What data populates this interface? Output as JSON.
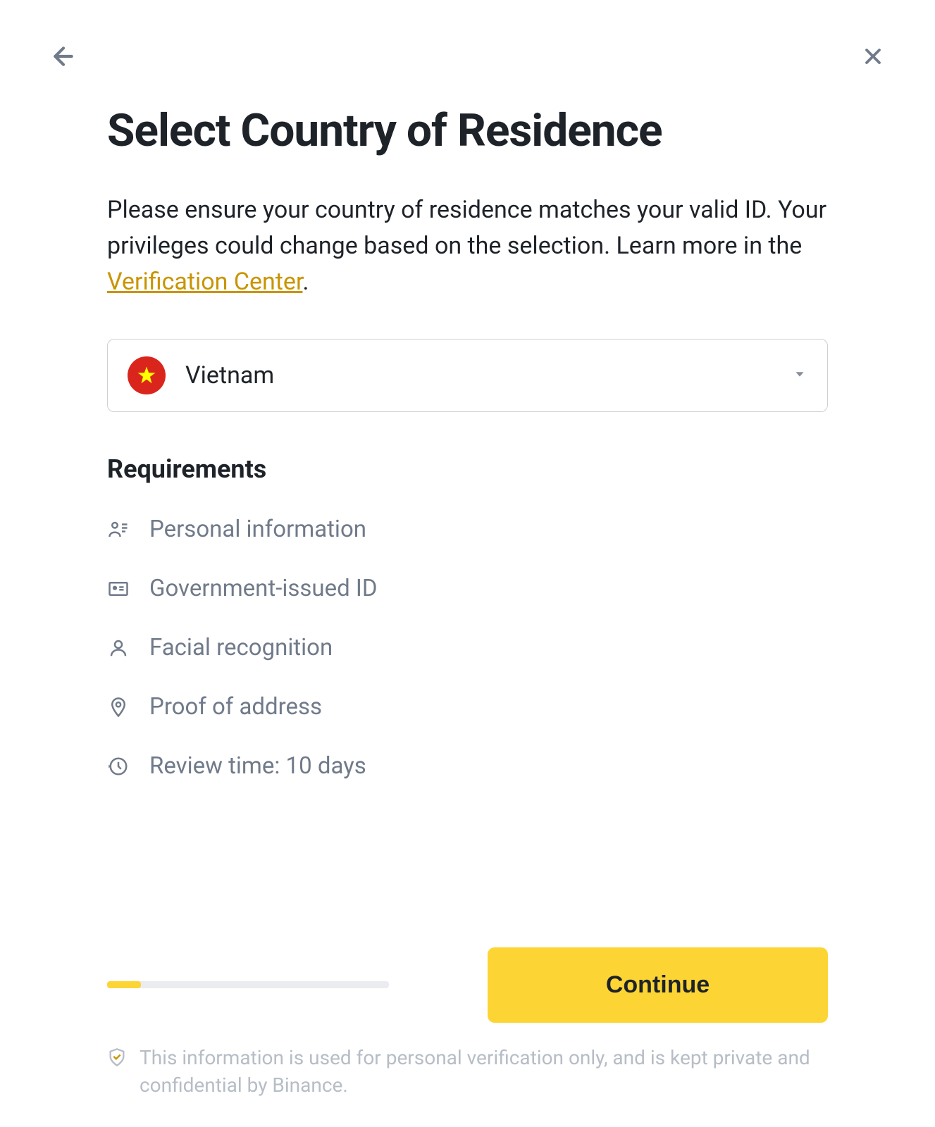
{
  "header": {
    "title": "Select Country of Residence"
  },
  "description": {
    "text_before_link": "Please ensure your country of residence matches your valid ID. Your privileges could change based on the selection. Learn more in the ",
    "link_text": "Verification Center",
    "text_after_link": "."
  },
  "country_select": {
    "selected": "Vietnam"
  },
  "requirements": {
    "heading": "Requirements",
    "items": [
      {
        "label": "Personal information"
      },
      {
        "label": "Government-issued ID"
      },
      {
        "label": "Facial recognition"
      },
      {
        "label": "Proof of address"
      },
      {
        "label": "Review time: 10 days"
      }
    ]
  },
  "progress": {
    "percent": 12
  },
  "actions": {
    "continue_label": "Continue"
  },
  "disclaimer": {
    "text": "This information is used for personal verification only, and is kept private and confidential by Binance."
  }
}
